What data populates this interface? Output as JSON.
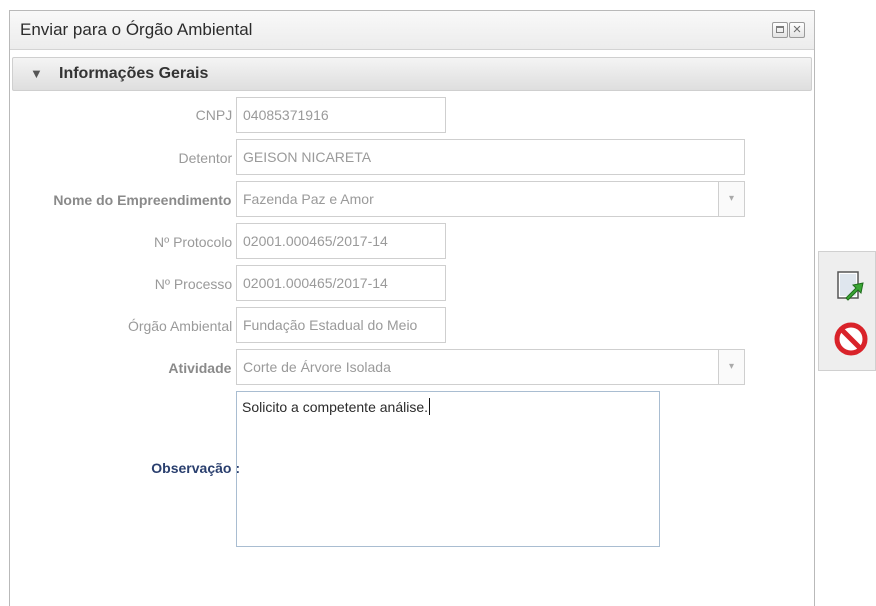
{
  "window": {
    "title": "Enviar para o Órgão Ambiental",
    "close_glyph": "×"
  },
  "section": {
    "title": "Informações Gerais",
    "chevron": "▼"
  },
  "form": {
    "cnpj": {
      "label": "CNPJ :",
      "value": "04085371916"
    },
    "detentor": {
      "label": "Detentor :",
      "value": "GEISON NICARETA"
    },
    "empreendimento": {
      "label": "Nome do Empreendimento :",
      "value": "Fazenda Paz e Amor"
    },
    "protocolo": {
      "label": "Nº Protocolo :",
      "value": "02001.000465/2017-14"
    },
    "processo": {
      "label": "Nº Processo :",
      "value": "02001.000465/2017-14"
    },
    "orgao": {
      "label": "Órgão Ambiental :",
      "value": "Fundação Estadual do Meio"
    },
    "atividade": {
      "label": "Atividade :",
      "value": "Corte de Árvore Isolada"
    },
    "observacao": {
      "label": "Observação :",
      "value": "Solicito a competente análise."
    },
    "combo_arrow": "▾"
  },
  "icons": {
    "maximize": "maximize-icon",
    "close": "close-icon",
    "send": "send-document-icon",
    "cancel": "cancel-icon"
  },
  "colors": {
    "observacao_label": "#2a3f6e",
    "cancel_red": "#d9232a",
    "send_green": "#3aa635"
  }
}
